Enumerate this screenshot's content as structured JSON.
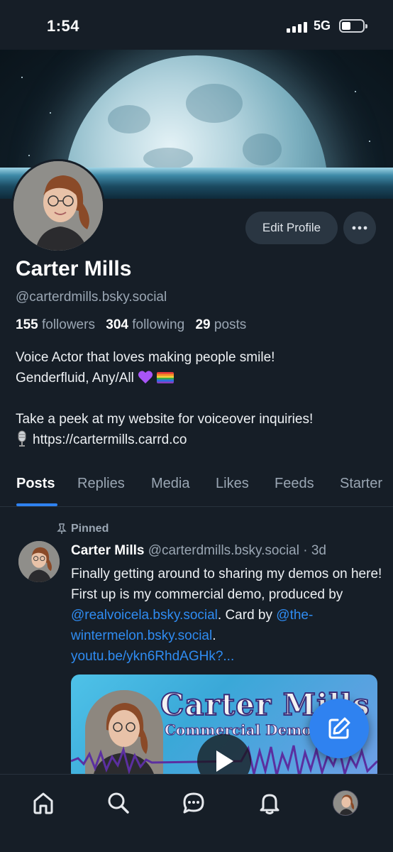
{
  "status_bar": {
    "time": "1:54",
    "network": "5G"
  },
  "profile": {
    "display_name": "Carter Mills",
    "handle": "@carterdmills.bsky.social",
    "followers_count": "155",
    "followers_label": "followers",
    "following_count": "304",
    "following_label": "following",
    "posts_count": "29",
    "posts_label": "posts",
    "bio_line1": "Voice Actor that loves making people smile!",
    "bio_line2": "Genderfluid, Any/All",
    "bio_line3": "Take a peek at my website for voiceover inquiries!",
    "bio_link": "https://cartermills.carrd.co",
    "edit_button": "Edit Profile"
  },
  "tabs": [
    "Posts",
    "Replies",
    "Media",
    "Likes",
    "Feeds",
    "Starter"
  ],
  "post": {
    "pinned_label": "Pinned",
    "author_name": "Carter Mills",
    "author_handle": "@carterdmills.bsky.social",
    "time_ago": "· 3d",
    "text_part1": "Finally getting around to sharing my demos on here! First up is my commercial demo, produced by ",
    "mention1": "@realvoicela.bsky.social",
    "text_part2": ". Card by ",
    "mention2": "@the-wintermelon.bsky.social",
    "text_part3": ".",
    "link": "youtu.be/ykn6RhdAGHk?...",
    "card_title": "Carter Mills",
    "card_subtitle": "Commercial Demo"
  },
  "colors": {
    "background": "#161e27",
    "accent": "#2f82f0",
    "link": "#2f8cf2",
    "muted": "#9aa6b3"
  },
  "icons": {
    "nav": [
      "home-icon",
      "search-icon",
      "chat-icon",
      "bell-icon",
      "profile-avatar"
    ],
    "fab": "compose-icon"
  }
}
